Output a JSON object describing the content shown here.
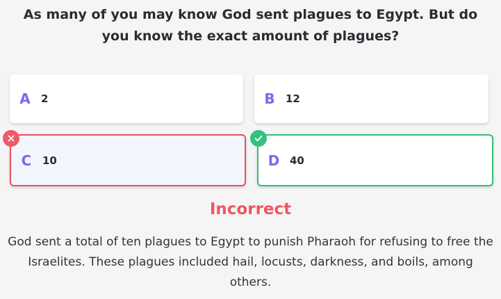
{
  "question": "As many of you may know God sent plagues to Egypt. But do you know the exact amount of plagues?",
  "options": [
    {
      "letter": "A",
      "value": "2",
      "state": "default"
    },
    {
      "letter": "B",
      "value": "12",
      "state": "default"
    },
    {
      "letter": "C",
      "value": "10",
      "state": "selected-incorrect",
      "badge_icon": "close-icon"
    },
    {
      "letter": "D",
      "value": "40",
      "state": "correct",
      "badge_icon": "check-icon"
    }
  ],
  "result": {
    "verdict": "Incorrect",
    "explanation": "God sent a total of ten plagues to Egypt to punish Pharaoh for refusing to free the Israelites. These plagues included hail, locusts, darkness, and boils, among others."
  },
  "colors": {
    "accent_letter": "#7b68ee",
    "incorrect": "#ee5a68",
    "correct": "#33c27f",
    "selected_background": "#f3f6fc"
  }
}
